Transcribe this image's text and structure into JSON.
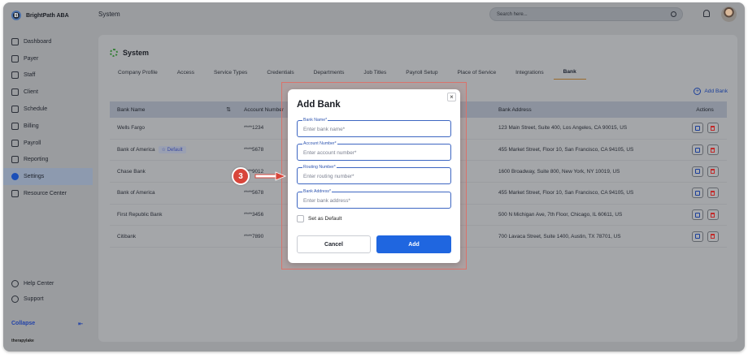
{
  "app": {
    "name": "BrightPath ABA",
    "footer_brand": "therapylake"
  },
  "header": {
    "title": "System",
    "search_placeholder": "Search here..."
  },
  "sidebar": {
    "items": [
      {
        "label": "Dashboard",
        "icon": "dashboard-icon",
        "active": false
      },
      {
        "label": "Payer",
        "icon": "payer-icon",
        "active": false
      },
      {
        "label": "Staff",
        "icon": "staff-icon",
        "active": false
      },
      {
        "label": "Client",
        "icon": "client-icon",
        "active": false
      },
      {
        "label": "Schedule",
        "icon": "calendar-icon",
        "active": false
      },
      {
        "label": "Billing",
        "icon": "billing-icon",
        "active": false
      },
      {
        "label": "Payroll",
        "icon": "payroll-icon",
        "active": false
      },
      {
        "label": "Reporting",
        "icon": "reporting-icon",
        "active": false
      },
      {
        "label": "Settings",
        "icon": "settings-icon",
        "active": true
      },
      {
        "label": "Resource Center",
        "icon": "folder-icon",
        "active": false
      }
    ],
    "bottom": [
      {
        "label": "Help Center",
        "icon": "help-icon"
      },
      {
        "label": "Support",
        "icon": "headset-icon"
      }
    ],
    "collapse_label": "Collapse",
    "collapse_icon": "⇤"
  },
  "page": {
    "title": "System",
    "tabs": [
      "Company Profile",
      "Access",
      "Service Types",
      "Credentials",
      "Departments",
      "Job Titles",
      "Payroll Setup",
      "Place of Service",
      "Integrations",
      "Bank"
    ],
    "active_tab": "Bank",
    "add_bank_label": "Add Bank"
  },
  "table": {
    "headers": {
      "bank_name": "Bank Name",
      "account_number": "Account Number",
      "bank_address": "Bank Address",
      "actions": "Actions"
    },
    "rows": [
      {
        "bank_name": "Wells Fargo",
        "badge": "",
        "account": "****1234",
        "address": "123 Main Street, Suite 400, Los Angeles, CA 90015, US"
      },
      {
        "bank_name": "Bank of America",
        "badge": "☆ Default",
        "account": "****5678",
        "address": "455 Market Street, Floor 10, San Francisco, CA 94105, US"
      },
      {
        "bank_name": "Chase Bank",
        "badge": "",
        "account": "****9012",
        "address": "1600 Broadway, Suite 800, New York, NY 10019, US"
      },
      {
        "bank_name": "Bank of America",
        "badge": "",
        "account": "****5678",
        "address": "455 Market Street, Floor 10, San Francisco, CA 94105, US"
      },
      {
        "bank_name": "First Republic Bank",
        "badge": "",
        "account": "****3456",
        "address": "500 N Michigan Ave, 7th Floor, Chicago, IL 60611, US"
      },
      {
        "bank_name": "Citibank",
        "badge": "",
        "account": "****7890",
        "address": "700 Lavaca Street, Suite 1400, Austin, TX 78701, US"
      }
    ]
  },
  "modal": {
    "title": "Add Bank",
    "close": "×",
    "fields": [
      {
        "label": "Bank Name*",
        "placeholder": "Enter bank name*"
      },
      {
        "label": "Account Number*",
        "placeholder": "Enter account number*"
      },
      {
        "label": "Routing Number*",
        "placeholder": "Enter routing number*"
      },
      {
        "label": "Bank Address*",
        "placeholder": "Enter bank address*"
      }
    ],
    "checkbox_label": "Set as Default",
    "cancel_label": "Cancel",
    "add_label": "Add"
  },
  "step_marker": {
    "number": "3",
    "color": "#d8463b"
  },
  "colors": {
    "primary": "#1f66e0",
    "accent": "#d8463b"
  }
}
